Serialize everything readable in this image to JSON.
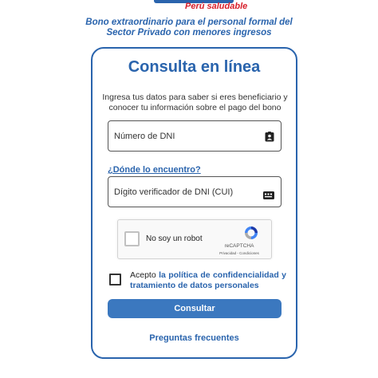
{
  "logo": {
    "tagline": "Perú saludable"
  },
  "header": {
    "line1": "Bono extraordinario para el personal formal del",
    "line2": "Sector Privado con menores ingresos"
  },
  "card": {
    "title": "Consulta en línea",
    "desc_line1": "Ingresa tus datos para saber si eres beneficiario y",
    "desc_line2": "conocer tu información sobre el pago del bono"
  },
  "form": {
    "dni_placeholder": "Número de DNI",
    "dni_value": "",
    "help_link": "¿Dónde lo encuentro?",
    "cui_placeholder": "Dígito verificador de DNI (CUI)",
    "cui_value": ""
  },
  "captcha": {
    "label": "No soy un robot",
    "brand": "reCAPTCHA",
    "links": "Privacidad - Condiciones",
    "checked": false
  },
  "consent": {
    "prefix": "Acepto",
    "link": "la política de confidencialidad y tratamiento de datos personales",
    "checked": false
  },
  "actions": {
    "submit": "Consultar",
    "faq": "Preguntas frecuentes"
  },
  "colors": {
    "primary": "#2a64ad",
    "button": "#3b78bf",
    "accent_red": "#d7202b"
  },
  "icons": {
    "dni": "id-badge-icon",
    "cui": "id-card-icon",
    "captcha": "recaptcha-icon"
  }
}
